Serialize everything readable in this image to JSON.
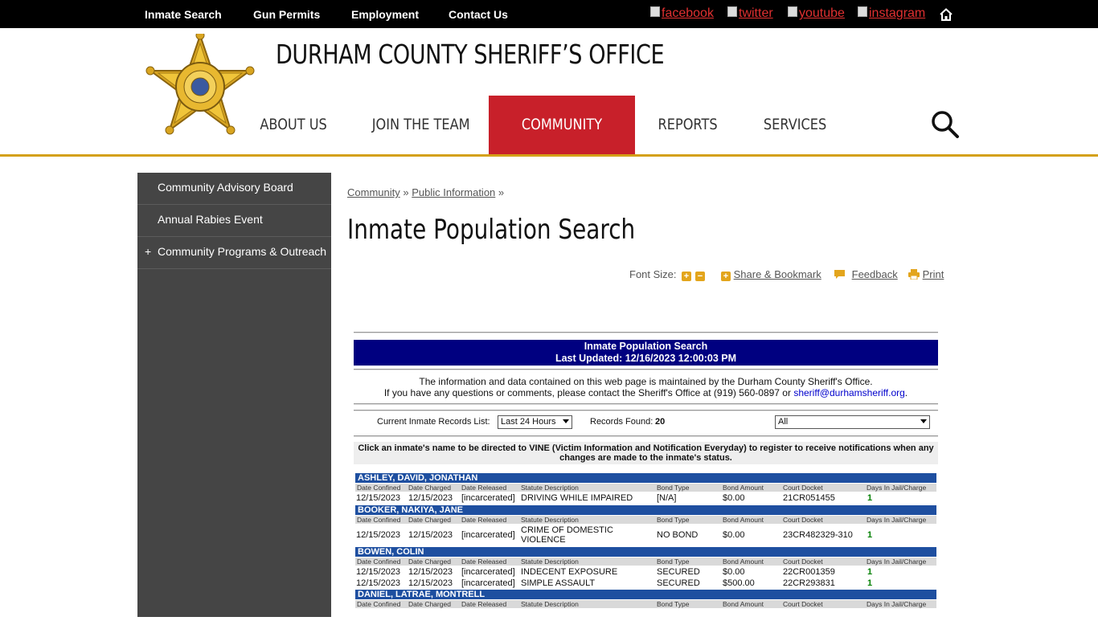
{
  "topbar": {
    "links": [
      "Inmate Search",
      "Gun Permits",
      "Employment",
      "Contact Us"
    ],
    "social": [
      "facebook",
      "twitter",
      "youtube",
      "instagram"
    ],
    "home_icon": "home-icon"
  },
  "header": {
    "site_title": "DURHAM COUNTY SHERIFF’S OFFICE",
    "badge_icon": "sheriff-star-badge",
    "nav": [
      "ABOUT US",
      "JOIN THE TEAM",
      "COMMUNITY",
      "REPORTS",
      "SERVICES"
    ],
    "active_nav": "COMMUNITY",
    "search_icon": "search-icon",
    "accent_color": "#c8202a",
    "gold_color": "#d4a017"
  },
  "sidebar": {
    "items": [
      {
        "label": "Community Advisory Board",
        "expandable": false
      },
      {
        "label": "Annual Rabies Event",
        "expandable": false
      },
      {
        "label": "Community Programs & Outreach",
        "expandable": true,
        "expander": "+"
      }
    ]
  },
  "breadcrumb": {
    "items": [
      "Community",
      "Public Information"
    ],
    "separator": "»"
  },
  "page": {
    "title": "Inmate Population Search",
    "tools": {
      "font_size_label": "Font Size:",
      "share_label": "Share & Bookmark",
      "feedback_label": "Feedback",
      "print_label": "Print"
    }
  },
  "report": {
    "banner_title": "Inmate Population Search",
    "banner_updated": "Last Updated: 12/16/2023 12:00:03 PM",
    "info_line1": "The information and data contained on this web page is maintained by the Durham County Sheriff's Office.",
    "info_line2_prefix": "If you have any questions or comments, please contact the Sheriff's Office at (919) 560-0897 or",
    "info_email": "sheriff@durhamsheriff.org",
    "info_line2_suffix": ".",
    "records_list_label": "Current Inmate Records List:",
    "records_list_value": "Last 24 Hours",
    "records_found_label": "Records Found:",
    "records_found_value": "20",
    "filter_value": "All",
    "notice": "Click an inmate's name to be directed to VINE (Victim Information and Notification Everyday) to register to receive notifications when any changes are made to the inmate's status.",
    "columns": [
      "Date Confined",
      "Date Charged",
      "Date Released",
      "Statute Description",
      "Bond Type",
      "Bond Amount",
      "Court Docket",
      "Days In Jail/Charge"
    ],
    "inmates": [
      {
        "name": "ASHLEY, DAVID, JONATHAN",
        "charges": [
          {
            "confined": "12/15/2023",
            "charged": "12/15/2023",
            "released": "[incarcerated]",
            "statute": "DRIVING WHILE IMPAIRED",
            "bond_type": "[N/A]",
            "bond_amount": "$0.00",
            "docket": "21CR051455",
            "days": "1"
          }
        ]
      },
      {
        "name": "BOOKER, NAKIYA, JANE",
        "charges": [
          {
            "confined": "12/15/2023",
            "charged": "12/15/2023",
            "released": "[incarcerated]",
            "statute": "CRIME OF DOMESTIC VIOLENCE",
            "statute_line1": "CRIME OF DOMESTIC",
            "statute_line2": "VIOLENCE",
            "bond_type": "NO BOND",
            "bond_amount": "$0.00",
            "docket": "23CR482329-310",
            "days": "1"
          }
        ]
      },
      {
        "name": "BOWEN, COLIN",
        "charges": [
          {
            "confined": "12/15/2023",
            "charged": "12/15/2023",
            "released": "[incarcerated]",
            "statute": "INDECENT EXPOSURE",
            "bond_type": "SECURED",
            "bond_amount": "$0.00",
            "docket": "22CR001359",
            "days": "1"
          },
          {
            "confined": "12/15/2023",
            "charged": "12/15/2023",
            "released": "[incarcerated]",
            "statute": "SIMPLE ASSAULT",
            "bond_type": "SECURED",
            "bond_amount": "$500.00",
            "docket": "22CR293831",
            "days": "1"
          }
        ]
      },
      {
        "name": "DANIEL, LATRAE, MONTRELL",
        "charges": []
      }
    ]
  }
}
